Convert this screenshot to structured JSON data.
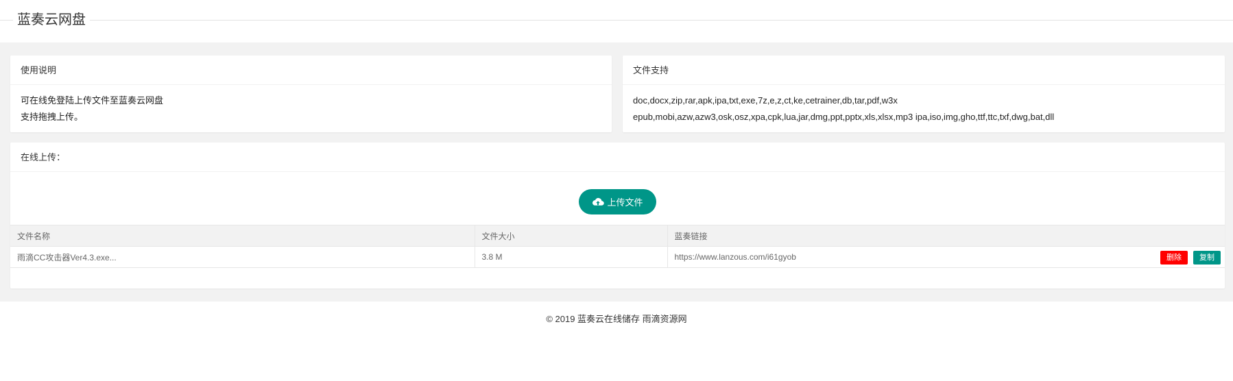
{
  "app": {
    "title": "蓝奏云网盘"
  },
  "usage": {
    "header": "使用说明",
    "lines": [
      "可在线免登陆上传文件至蓝奏云网盘",
      "支持拖拽上传。"
    ]
  },
  "formats": {
    "header": "文件支持",
    "lines": [
      "doc,docx,zip,rar,apk,ipa,txt,exe,7z,e,z,ct,ke,cetrainer,db,tar,pdf,w3x",
      "epub,mobi,azw,azw3,osk,osz,xpa,cpk,lua,jar,dmg,ppt,pptx,xls,xlsx,mp3 ipa,iso,img,gho,ttf,ttc,txf,dwg,bat,dll"
    ]
  },
  "upload": {
    "header": "在线上传：",
    "button_label": "上传文件",
    "button_icon": "cloud-upload-icon"
  },
  "table": {
    "columns": [
      "文件名称",
      "文件大小",
      "蓝奏链接"
    ],
    "rows": [
      {
        "name": "雨滴CC攻击器Ver4.3.exe...",
        "size": "3.8 M",
        "link": "https://www.lanzous.com/i61gyob",
        "delete_label": "删除",
        "copy_label": "复制"
      }
    ]
  },
  "footer": {
    "text": "© 2019 蓝奏云在线储存 雨滴资源网"
  },
  "colors": {
    "accent": "#009688",
    "danger": "#ff0000",
    "page_bg": "#f2f2f2"
  }
}
